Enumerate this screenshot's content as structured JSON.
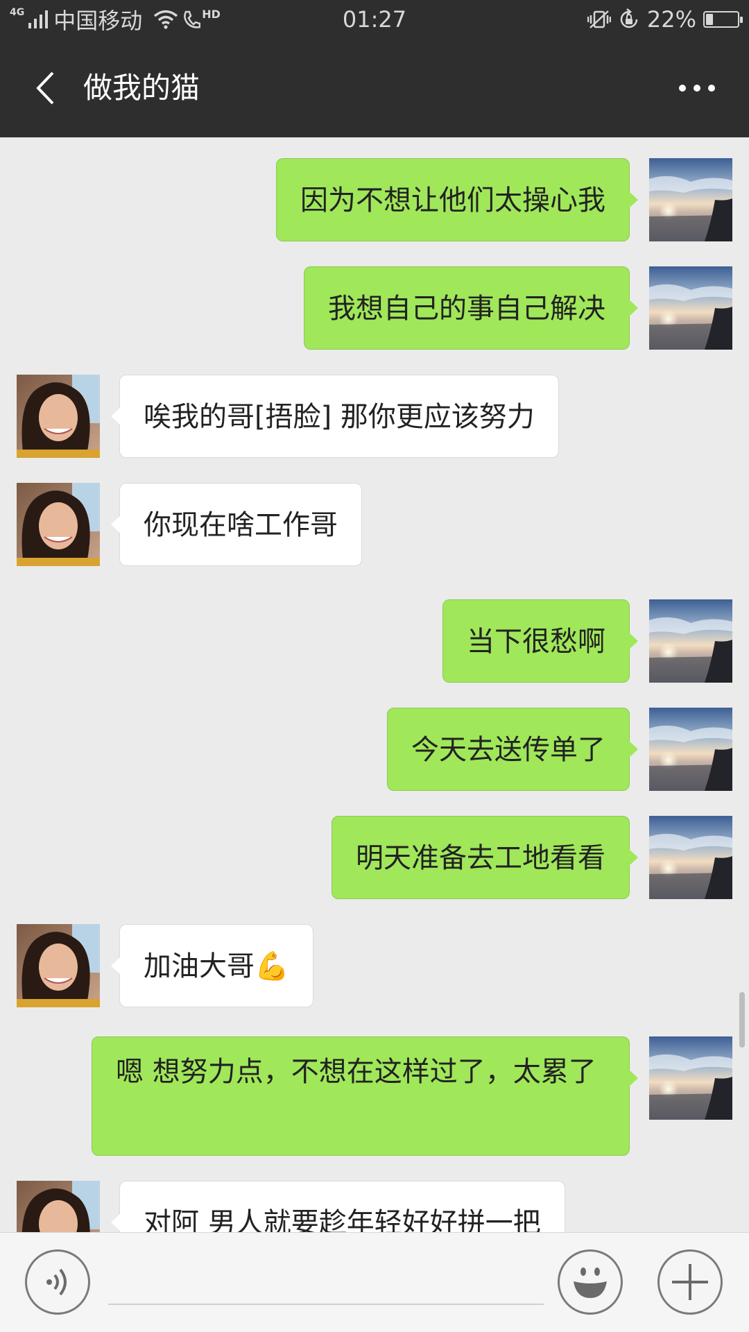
{
  "status_bar": {
    "network_type": "4G",
    "carrier": "中国移动",
    "hd_label": "HD",
    "time": "01:27",
    "battery_percent": "22%",
    "battery_level": 0.22
  },
  "header": {
    "title": "做我的猫"
  },
  "messages": [
    {
      "direction": "out",
      "text": "因为不想让他们太操心我"
    },
    {
      "direction": "out",
      "text": "我想自己的事自己解决"
    },
    {
      "direction": "in",
      "text": "唉我的哥[捂脸]  那你更应该努力"
    },
    {
      "direction": "in",
      "text": "你现在啥工作哥"
    },
    {
      "direction": "out",
      "text": "当下很愁啊"
    },
    {
      "direction": "out",
      "text": "今天去送传单了"
    },
    {
      "direction": "out",
      "text": "明天准备去工地看看"
    },
    {
      "direction": "in",
      "text": "加油大哥",
      "emoji": "💪"
    },
    {
      "direction": "out",
      "text": "嗯  想努力点，不想在这样过了，太累了"
    },
    {
      "direction": "in",
      "text": "对阿 男人就要趁年轻好好拼一把"
    }
  ],
  "input": {
    "value": "",
    "placeholder": ""
  },
  "colors": {
    "bar_background": "#2e2e2e",
    "chat_background": "#ebebeb",
    "outgoing_bubble": "#a0e75a",
    "incoming_bubble": "#ffffff"
  },
  "icons": [
    "signal-icon",
    "wifi-icon",
    "phone-hd-icon",
    "vibrate-icon",
    "rotation-lock-icon",
    "battery-icon",
    "back-arrow-icon",
    "more-icon",
    "voice-icon",
    "emoji-icon",
    "plus-icon"
  ]
}
